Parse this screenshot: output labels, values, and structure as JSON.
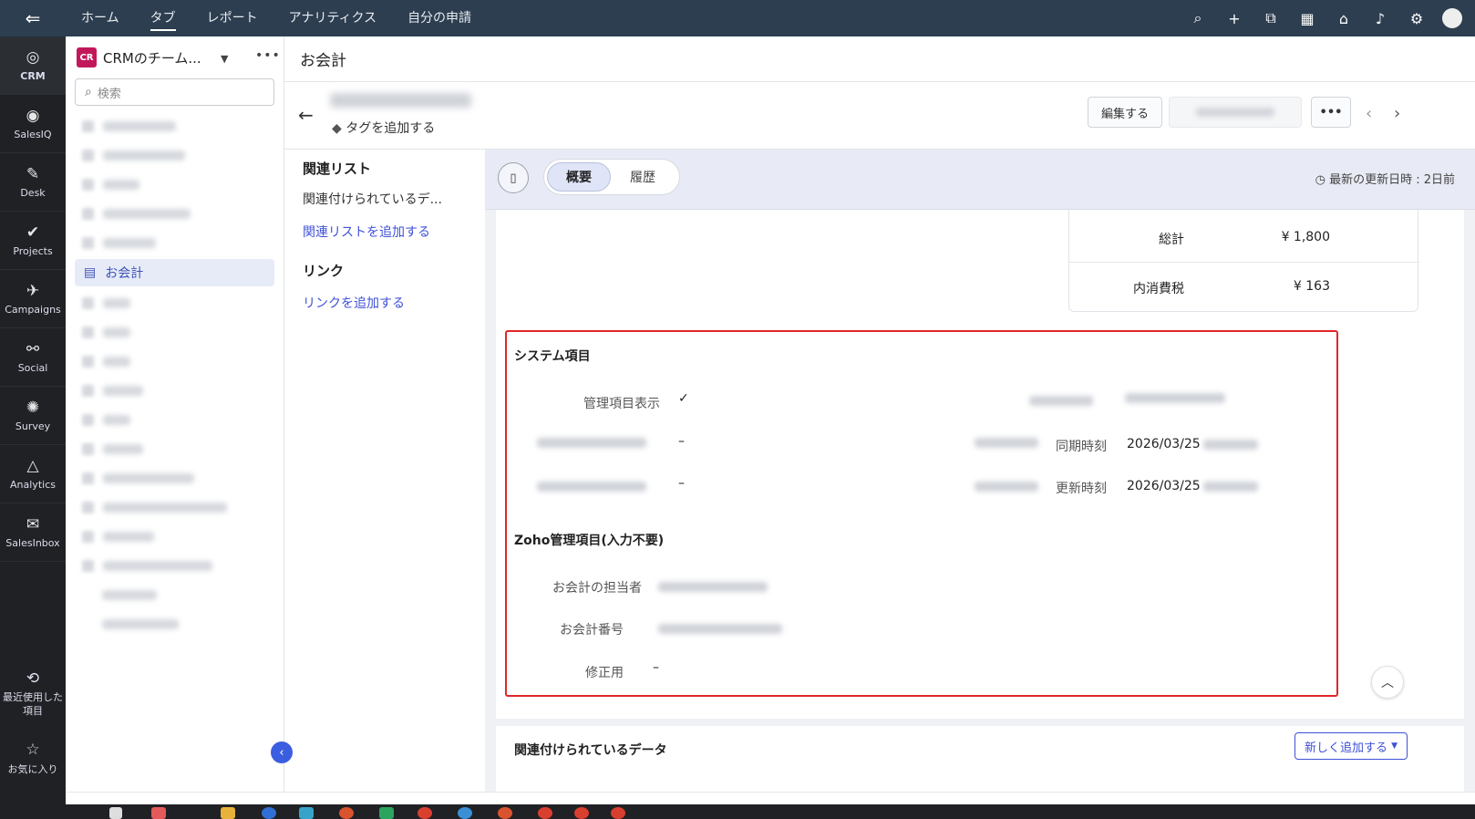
{
  "topbar": {
    "nav": [
      "ホーム",
      "タブ",
      "レポート",
      "アナリティクス",
      "自分の申請"
    ],
    "active_nav": "タブ",
    "icons": [
      "search-icon",
      "plus-icon",
      "activity-icon",
      "calendar-icon",
      "store-icon",
      "bell-icon",
      "gear-icon",
      "avatar"
    ]
  },
  "apps": {
    "items": [
      {
        "label": "CRM",
        "icon": "crm-icon"
      },
      {
        "label": "SalesIQ",
        "icon": "salesiq-icon"
      },
      {
        "label": "Desk",
        "icon": "desk-icon"
      },
      {
        "label": "Projects",
        "icon": "projects-icon"
      },
      {
        "label": "Campaigns",
        "icon": "campaigns-icon"
      },
      {
        "label": "Social",
        "icon": "social-icon"
      },
      {
        "label": "Survey",
        "icon": "survey-icon"
      },
      {
        "label": "Analytics",
        "icon": "analytics-icon"
      },
      {
        "label": "SalesInbox",
        "icon": "salesinbox-icon"
      }
    ],
    "recent_label": "最近使用した項目",
    "favorites_label": "お気に入り"
  },
  "sidebar": {
    "badge": "CR",
    "title": "CRMのチーム...",
    "search_placeholder": "検索",
    "active_item": "お会計"
  },
  "page": {
    "title": "お会計",
    "add_tag": "タグを追加する",
    "edit_button": "編集する",
    "more_button": "•••"
  },
  "related_panel": {
    "related_list_heading": "関連リスト",
    "related_item": "関連付けられているデ...",
    "add_related_list": "関連リストを追加する",
    "links_heading": "リンク",
    "add_link": "リンクを追加する"
  },
  "tabs": {
    "overview": "概要",
    "history": "履歴",
    "last_updated": "最新の更新日時 : 2日前"
  },
  "totals": {
    "rows": [
      {
        "label": "総計",
        "value": "¥ 1,800"
      },
      {
        "label": "内消費税",
        "value": "¥ 163"
      }
    ]
  },
  "system_section": {
    "heading": "システム項目",
    "managed_display_label": "管理項目表示",
    "managed_display_value": "✓",
    "dash1": "–",
    "dash2": "–",
    "sync_time_label": "同期時刻",
    "sync_time_value": "2026/03/25",
    "update_time_label": "更新時刻",
    "update_time_value": "2026/03/25"
  },
  "zoho_section": {
    "heading": "Zoho管理項目(入力不要)",
    "owner_label": "お会計の担当者",
    "number_label": "お会計番号",
    "fix_label": "修正用",
    "fix_value": "–"
  },
  "related_data": {
    "heading": "関連付けられているデータ",
    "add_new": "新しく追加する"
  }
}
